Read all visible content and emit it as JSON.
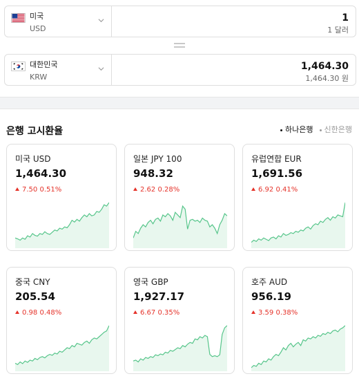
{
  "converter": {
    "from": {
      "flag": "us-flag",
      "name": "미국",
      "code": "USD",
      "amount": "1",
      "amount_sub": "1 달러"
    },
    "to": {
      "flag": "kr-flag",
      "name": "대한민국",
      "code": "KRW",
      "amount": "1,464.30",
      "amount_sub": "1,464.30 원"
    }
  },
  "section": {
    "title": "은행 고시환율",
    "banks": [
      {
        "label": "하나은행",
        "active": true
      },
      {
        "label": "신한은행",
        "active": false
      }
    ]
  },
  "colors": {
    "up": "#e5332a",
    "spark_line": "#56c58a",
    "spark_fill": "#e8f7ee"
  },
  "cards": [
    {
      "name": "미국 USD",
      "rate": "1,464.30",
      "change": "7.50",
      "pct": "0.51%",
      "trend": [
        0.2,
        0.18,
        0.15,
        0.2,
        0.17,
        0.25,
        0.22,
        0.3,
        0.26,
        0.24,
        0.3,
        0.28,
        0.34,
        0.3,
        0.28,
        0.33,
        0.38,
        0.36,
        0.42,
        0.4,
        0.45,
        0.43,
        0.5,
        0.6,
        0.56,
        0.62,
        0.58,
        0.66,
        0.72,
        0.68,
        0.75,
        0.7,
        0.72,
        0.8,
        0.78,
        0.85,
        0.95,
        0.92,
        1.0
      ]
    },
    {
      "name": "일본 JPY 100",
      "rate": "948.32",
      "change": "2.62",
      "pct": "0.28%",
      "trend": [
        0.2,
        0.35,
        0.3,
        0.42,
        0.5,
        0.45,
        0.55,
        0.6,
        0.52,
        0.62,
        0.65,
        0.58,
        0.72,
        0.68,
        0.75,
        0.7,
        0.6,
        0.78,
        0.72,
        0.66,
        0.92,
        0.85,
        0.4,
        0.6,
        0.62,
        0.58,
        0.6,
        0.55,
        0.65,
        0.6,
        0.58,
        0.45,
        0.5,
        0.42,
        0.3,
        0.5,
        0.6,
        0.75,
        0.7
      ]
    },
    {
      "name": "유럽연합 EUR",
      "rate": "1,691.56",
      "change": "6.92",
      "pct": "0.41%",
      "trend": [
        0.1,
        0.15,
        0.12,
        0.18,
        0.15,
        0.2,
        0.17,
        0.14,
        0.2,
        0.22,
        0.18,
        0.25,
        0.22,
        0.3,
        0.26,
        0.28,
        0.32,
        0.3,
        0.35,
        0.33,
        0.38,
        0.36,
        0.42,
        0.45,
        0.4,
        0.48,
        0.52,
        0.5,
        0.58,
        0.55,
        0.62,
        0.66,
        0.6,
        0.68,
        0.65,
        0.72,
        0.7,
        0.68,
        1.0
      ]
    },
    {
      "name": "중국 CNY",
      "rate": "205.54",
      "change": "0.98",
      "pct": "0.48%",
      "trend": [
        0.15,
        0.12,
        0.18,
        0.14,
        0.2,
        0.17,
        0.22,
        0.2,
        0.26,
        0.23,
        0.28,
        0.3,
        0.27,
        0.32,
        0.35,
        0.33,
        0.38,
        0.36,
        0.42,
        0.4,
        0.45,
        0.5,
        0.48,
        0.55,
        0.52,
        0.6,
        0.58,
        0.56,
        0.62,
        0.65,
        0.6,
        0.68,
        0.72,
        0.7,
        0.75,
        0.8,
        0.85,
        0.88,
        1.0
      ]
    },
    {
      "name": "영국 GBP",
      "rate": "1,927.17",
      "change": "6.67",
      "pct": "0.35%",
      "trend": [
        0.2,
        0.22,
        0.18,
        0.25,
        0.22,
        0.28,
        0.26,
        0.3,
        0.28,
        0.34,
        0.32,
        0.36,
        0.34,
        0.4,
        0.38,
        0.44,
        0.42,
        0.46,
        0.5,
        0.48,
        0.55,
        0.52,
        0.58,
        0.62,
        0.6,
        0.7,
        0.68,
        0.75,
        0.72,
        0.78,
        0.75,
        0.35,
        0.3,
        0.32,
        0.3,
        0.34,
        0.8,
        0.95,
        1.0
      ]
    },
    {
      "name": "호주 AUD",
      "rate": "956.19",
      "change": "3.59",
      "pct": "0.38%",
      "trend": [
        0.05,
        0.1,
        0.08,
        0.15,
        0.12,
        0.2,
        0.18,
        0.25,
        0.22,
        0.3,
        0.35,
        0.32,
        0.4,
        0.5,
        0.45,
        0.55,
        0.6,
        0.52,
        0.58,
        0.62,
        0.55,
        0.68,
        0.65,
        0.72,
        0.7,
        0.75,
        0.72,
        0.78,
        0.76,
        0.82,
        0.8,
        0.85,
        0.82,
        0.88,
        0.9,
        0.86,
        0.92,
        0.95,
        1.0
      ]
    }
  ]
}
